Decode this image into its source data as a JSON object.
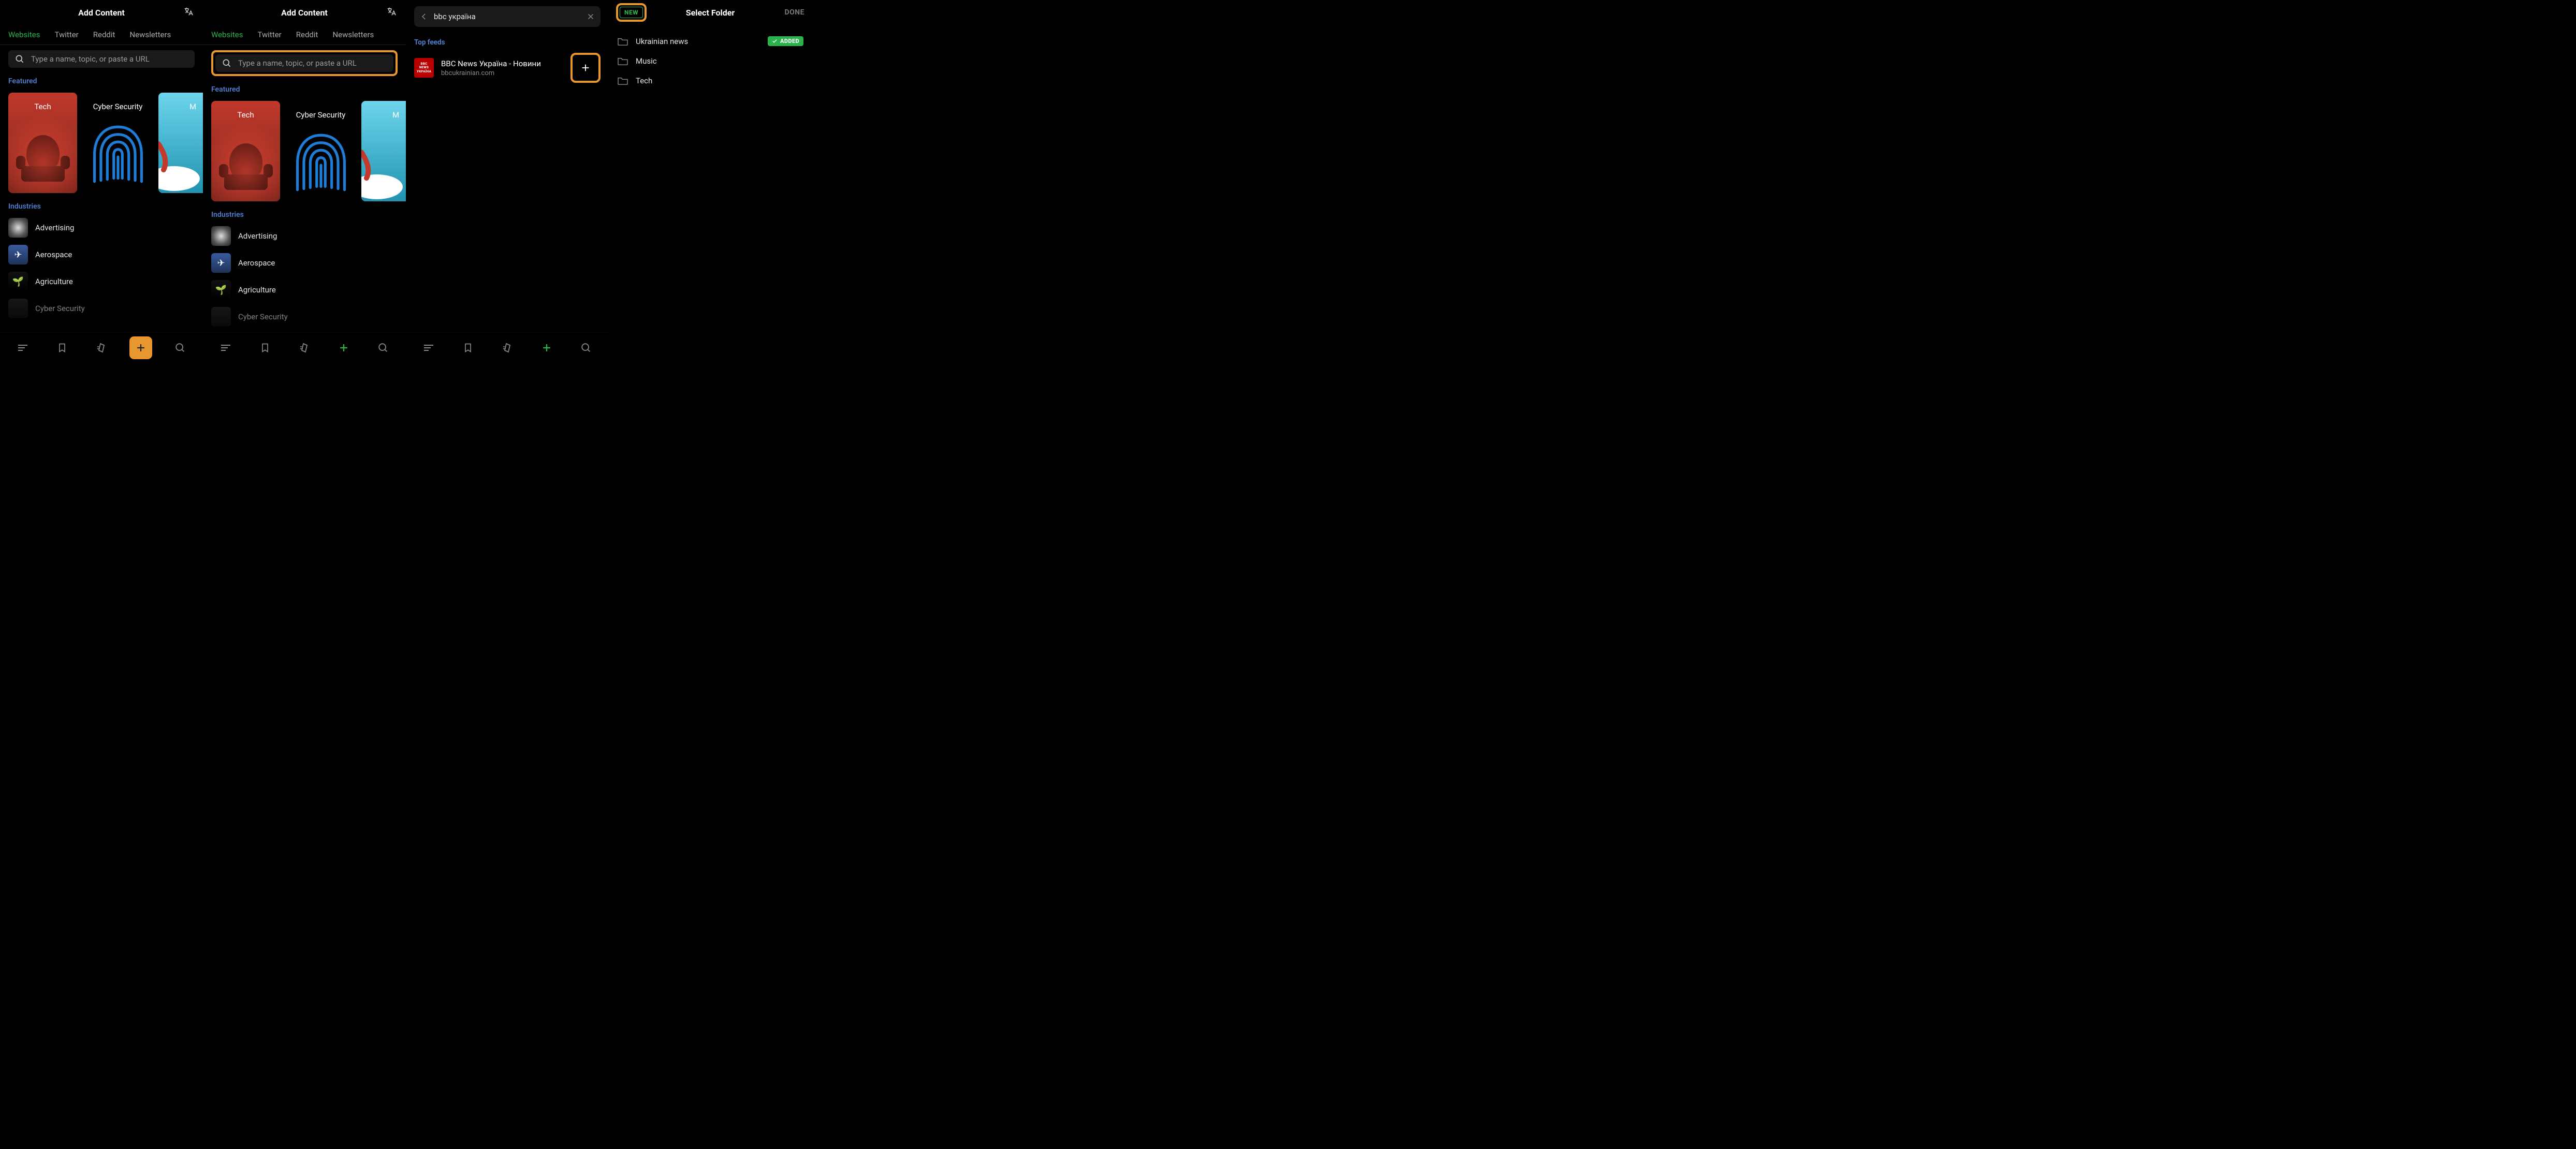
{
  "common": {
    "header_title": "Add Content",
    "search_placeholder": "Type a name, topic, or paste a URL",
    "tabs": {
      "websites": "Websites",
      "twitter": "Twitter",
      "reddit": "Reddit",
      "newsletters": "Newsletters"
    },
    "featured_label": "Featured",
    "featured": {
      "tech": "Tech",
      "cyber": "Cyber Security",
      "mail_partial": "M"
    },
    "industries_label": "Industries",
    "industries": {
      "advertising": "Advertising",
      "aerospace": "Aerospace",
      "agriculture": "Agriculture",
      "cyber_cut": "Cyber Security"
    }
  },
  "screen3": {
    "search_value": "bbc україна",
    "top_feeds_label": "Top feeds",
    "feed": {
      "logo_lines": {
        "l1": "BBC",
        "l2": "NEWS",
        "l3": "УКРАЇНА"
      },
      "title": "BBC News Україна - Новини",
      "domain": "bbcukrainian.com"
    }
  },
  "screen4": {
    "title": "Select Folder",
    "new_label": "NEW",
    "done_label": "DONE",
    "added_label": "ADDED",
    "folders": {
      "f1": "Ukrainian news",
      "f2": "Music",
      "f3": "Tech"
    }
  }
}
